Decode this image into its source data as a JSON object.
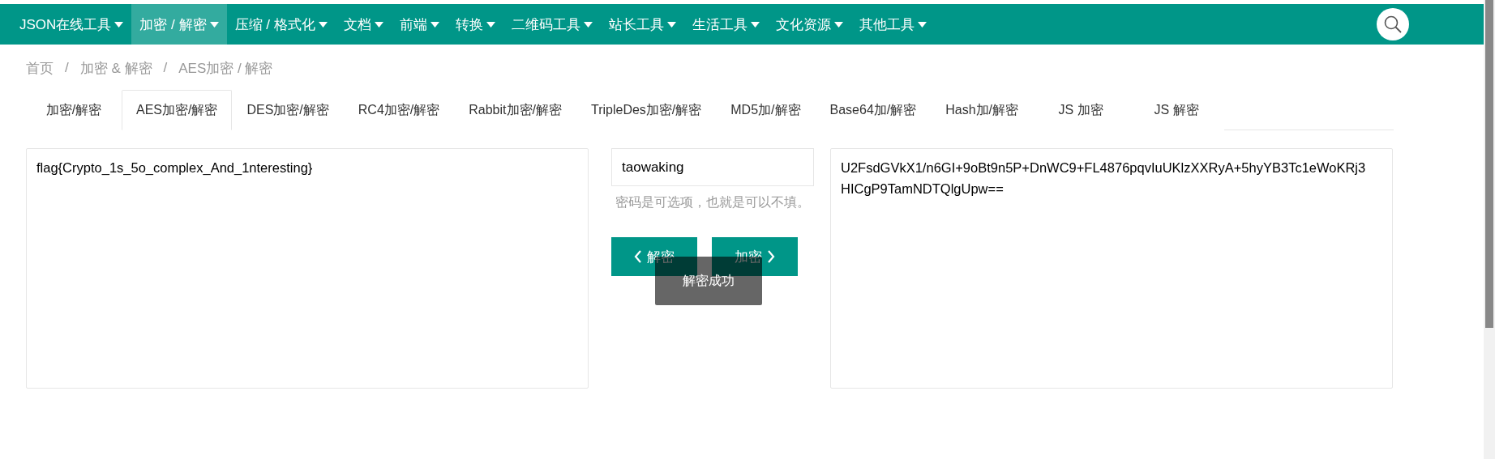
{
  "navbar": {
    "items": [
      {
        "label": "JSON在线工具",
        "selected": false
      },
      {
        "label": "加密 / 解密",
        "selected": true
      },
      {
        "label": "压缩 / 格式化",
        "selected": false
      },
      {
        "label": "文档",
        "selected": false
      },
      {
        "label": "前端",
        "selected": false
      },
      {
        "label": "转换",
        "selected": false
      },
      {
        "label": "二维码工具",
        "selected": false
      },
      {
        "label": "站长工具",
        "selected": false
      },
      {
        "label": "生活工具",
        "selected": false
      },
      {
        "label": "文化资源",
        "selected": false
      },
      {
        "label": "其他工具",
        "selected": false
      }
    ]
  },
  "breadcrumb": {
    "separator": "/",
    "items": [
      "首页",
      "加密 & 解密",
      "AES加密 / 解密"
    ]
  },
  "tabs": [
    {
      "label": "加密/解密",
      "selected": false
    },
    {
      "label": "AES加密/解密",
      "selected": true
    },
    {
      "label": "DES加密/解密",
      "selected": false
    },
    {
      "label": "RC4加密/解密",
      "selected": false
    },
    {
      "label": "Rabbit加密/解密",
      "selected": false
    },
    {
      "label": "TripleDes加密/解密",
      "selected": false
    },
    {
      "label": "MD5加/解密",
      "selected": false
    },
    {
      "label": "Base64加/解密",
      "selected": false
    },
    {
      "label": "Hash加/解密",
      "selected": false
    },
    {
      "label": "JS 加密",
      "selected": false
    },
    {
      "label": "JS 解密",
      "selected": false
    }
  ],
  "plaintext": "flag{Crypto_1s_5o_complex_And_1nteresting}",
  "password": {
    "value": "taowaking",
    "hint": "密码是可选项，也就是可以不填。"
  },
  "buttons": {
    "decrypt": "解密",
    "encrypt": "加密"
  },
  "toast": "解密成功",
  "ciphertext": "U2FsdGVkX1/n6GI+9oBt9n5P+DnWC9+FL4876pqvIuUKlzXXRyA+5hyYB3Tc1eWoKRj3HICgP9TamNDTQlgUpw=="
}
